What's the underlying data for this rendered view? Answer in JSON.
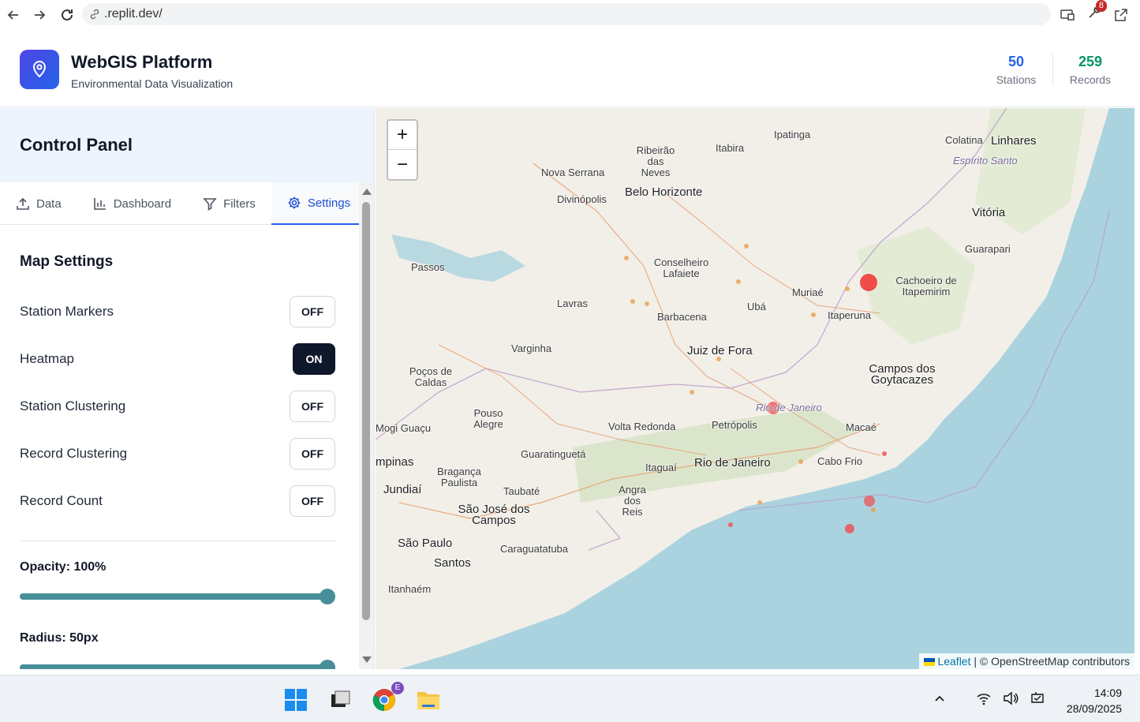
{
  "browser": {
    "url": ".replit.dev/",
    "extension_badge": "8"
  },
  "header": {
    "title": "WebGIS Platform",
    "subtitle": "Environmental Data Visualization",
    "stats": [
      {
        "value": "50",
        "label": "Stations",
        "color": "#2563eb"
      },
      {
        "value": "259",
        "label": "Records",
        "color": "#059669"
      }
    ]
  },
  "panel": {
    "title": "Control Panel",
    "tabs": [
      {
        "label": "Data",
        "icon": "upload-icon"
      },
      {
        "label": "Dashboard",
        "icon": "bar-chart-icon"
      },
      {
        "label": "Filters",
        "icon": "filter-icon"
      },
      {
        "label": "Settings",
        "icon": "gear-icon",
        "active": true
      }
    ],
    "section_title": "Map Settings",
    "toggles": [
      {
        "label": "Station Markers",
        "state": "OFF"
      },
      {
        "label": "Heatmap",
        "state": "ON"
      },
      {
        "label": "Station Clustering",
        "state": "OFF"
      },
      {
        "label": "Record Clustering",
        "state": "OFF"
      },
      {
        "label": "Record Count",
        "state": "OFF"
      }
    ],
    "opacity_label": "Opacity: 100%",
    "opacity_value": 1.0,
    "radius_label": "Radius: 50px",
    "radius_value": 1.0
  },
  "map": {
    "zoom_in": "+",
    "zoom_out": "−",
    "attribution_leaflet": "Leaflet",
    "attribution_rest": " | © OpenStreetMap contributors",
    "places": [
      "Ipatinga",
      "Itabira",
      "Ribeirão das Neves",
      "Nova Serrana",
      "Belo Horizonte",
      "Divinópolis",
      "Colatina",
      "Linhares",
      "Espírito Santo",
      "Vitória",
      "Guarapari",
      "Passos",
      "Conselheiro Lafaiete",
      "Lavras",
      "Barbacena",
      "Ubá",
      "Muriaé",
      "Itaperuna",
      "Cachoeiro de Itapemirim",
      "Varginha",
      "Juiz de Fora",
      "Poços de Caldas",
      "Campos dos Goytacazes",
      "Rio de Janeiro",
      "Pouso Alegre",
      "Volta Redonda",
      "Petrópolis",
      "Macaé",
      "Guaratinguetá",
      "Itaguaí",
      "Cabo Frio",
      "Bragança Paulista",
      "Taubaté",
      "Angra dos Reis",
      "Jundiaí",
      "São José dos Campos",
      "Caraguatatuba",
      "São Paulo",
      "Santos",
      "Itanhaém",
      "mpinas",
      "Mogi Guaçu"
    ]
  },
  "taskbar": {
    "time": "14:09",
    "date": "28/09/2025"
  }
}
